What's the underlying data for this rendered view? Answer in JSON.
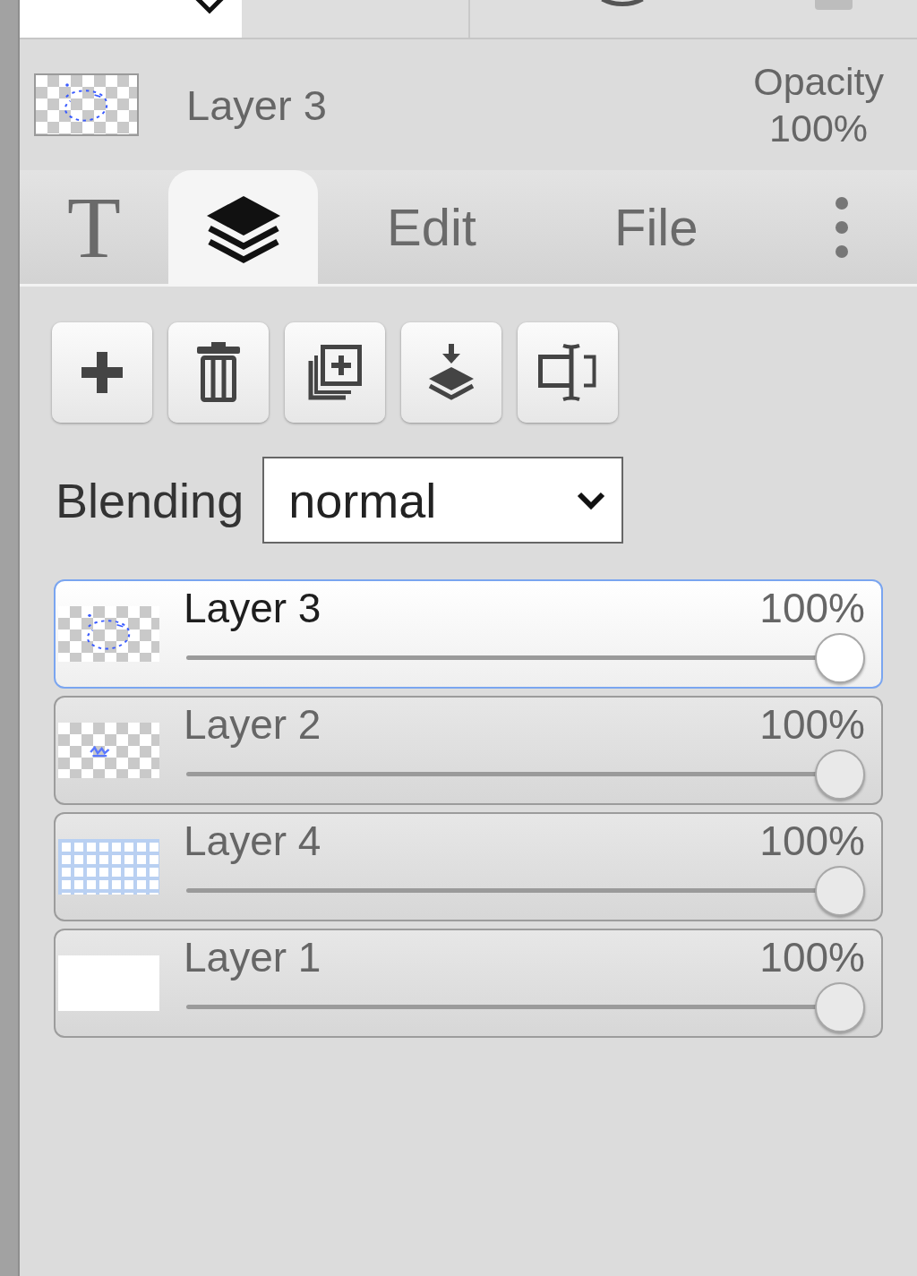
{
  "header": {
    "kind": "strokes",
    "name": "Layer 3",
    "opacity_label": "Opacity",
    "opacity": "100%"
  },
  "tabs": [
    {
      "kind": "glyph",
      "label": "T",
      "selected": false
    },
    {
      "kind": "icon",
      "selected": true
    },
    {
      "kind": "text",
      "label": "Edit",
      "selected": false
    },
    {
      "kind": "text",
      "label": "File",
      "selected": false
    },
    {
      "kind": "menu",
      "selected": false
    }
  ],
  "blending": {
    "label": "Blending",
    "value": "normal"
  },
  "layers": [
    {
      "kind": "strokes",
      "name": "Layer 3",
      "opacity": "100%",
      "level": 1,
      "selected": true
    },
    {
      "kind": "scribble",
      "name": "Layer 2",
      "opacity": "100%",
      "level": 1,
      "selected": false
    },
    {
      "kind": "grid",
      "name": "Layer 4",
      "opacity": "100%",
      "level": 1,
      "selected": false
    },
    {
      "kind": "blank",
      "name": "Layer 1",
      "opacity": "100%",
      "level": 1,
      "selected": false
    }
  ]
}
